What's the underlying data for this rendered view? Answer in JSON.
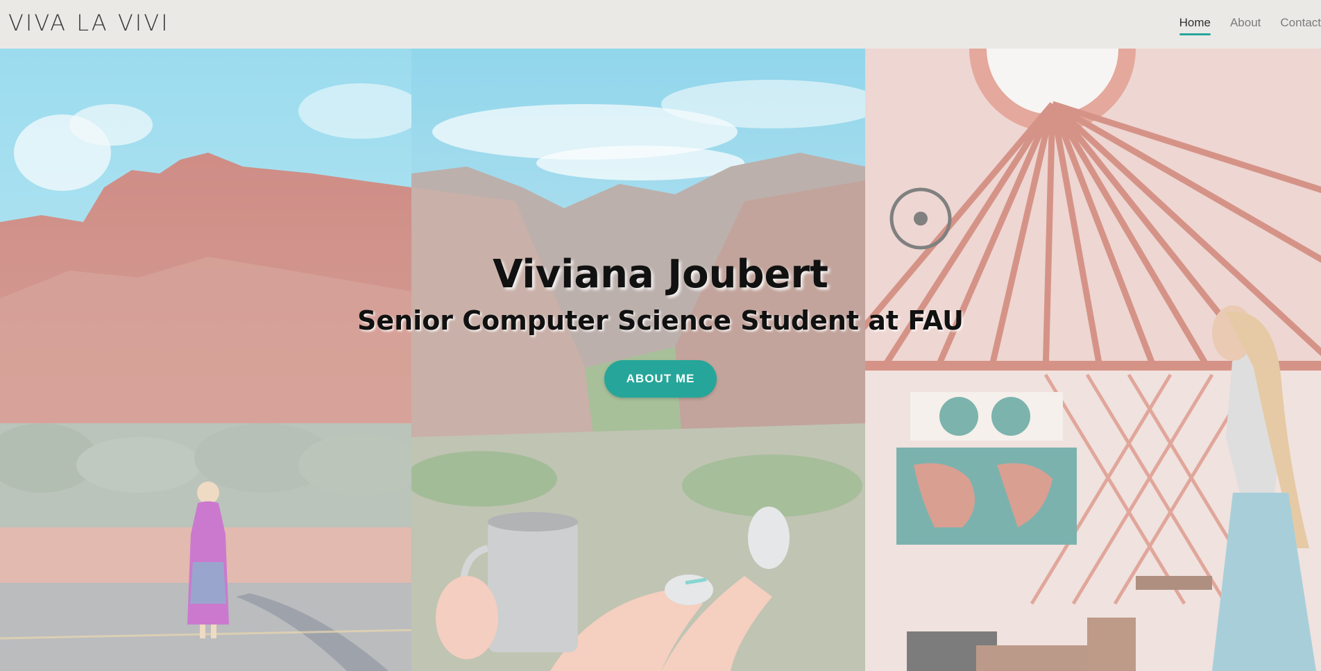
{
  "header": {
    "brand": "VIVA LA VIVI",
    "nav": [
      {
        "label": "Home",
        "active": true
      },
      {
        "label": "About",
        "active": false
      },
      {
        "label": "Contact",
        "active": false
      }
    ]
  },
  "hero": {
    "title": "Viviana Joubert",
    "subtitle": "Senior Computer Science Student at FAU",
    "button_label": "ABOUT ME"
  },
  "colors": {
    "accent": "#26a69a",
    "nav_bg": "#ebe9e6",
    "title": "#111111"
  }
}
